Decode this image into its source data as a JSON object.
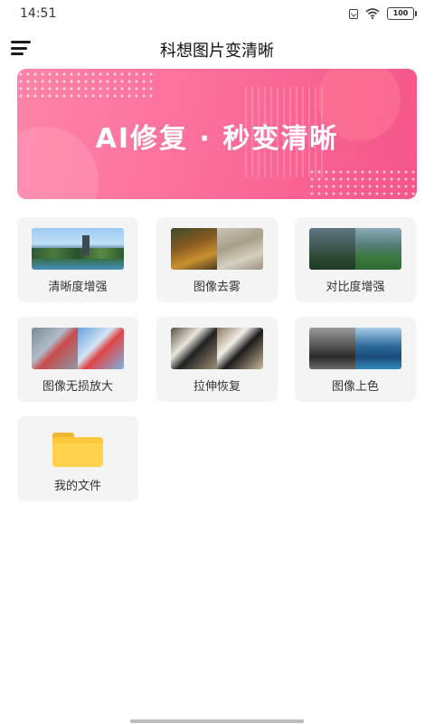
{
  "status_bar": {
    "time": "14:51",
    "battery": "100"
  },
  "header": {
    "title": "科想图片变清晰"
  },
  "banner": {
    "text": "AI修复 · 秒变清晰"
  },
  "features": [
    {
      "label": "清晰度增强"
    },
    {
      "label": "图像去雾"
    },
    {
      "label": "对比度增强"
    },
    {
      "label": "图像无损放大"
    },
    {
      "label": "拉伸恢复"
    },
    {
      "label": "图像上色"
    },
    {
      "label": "我的文件"
    }
  ],
  "icons": {
    "menu": "hamburger-menu-icon",
    "folder": "folder-icon",
    "wifi": "wifi-icon",
    "sim": "sim-icon",
    "battery": "battery-icon"
  },
  "colors": {
    "banner_start": "#ff84a8",
    "banner_end": "#f5558a",
    "card_bg": "#f4f4f5",
    "folder": "#ffc83a"
  }
}
